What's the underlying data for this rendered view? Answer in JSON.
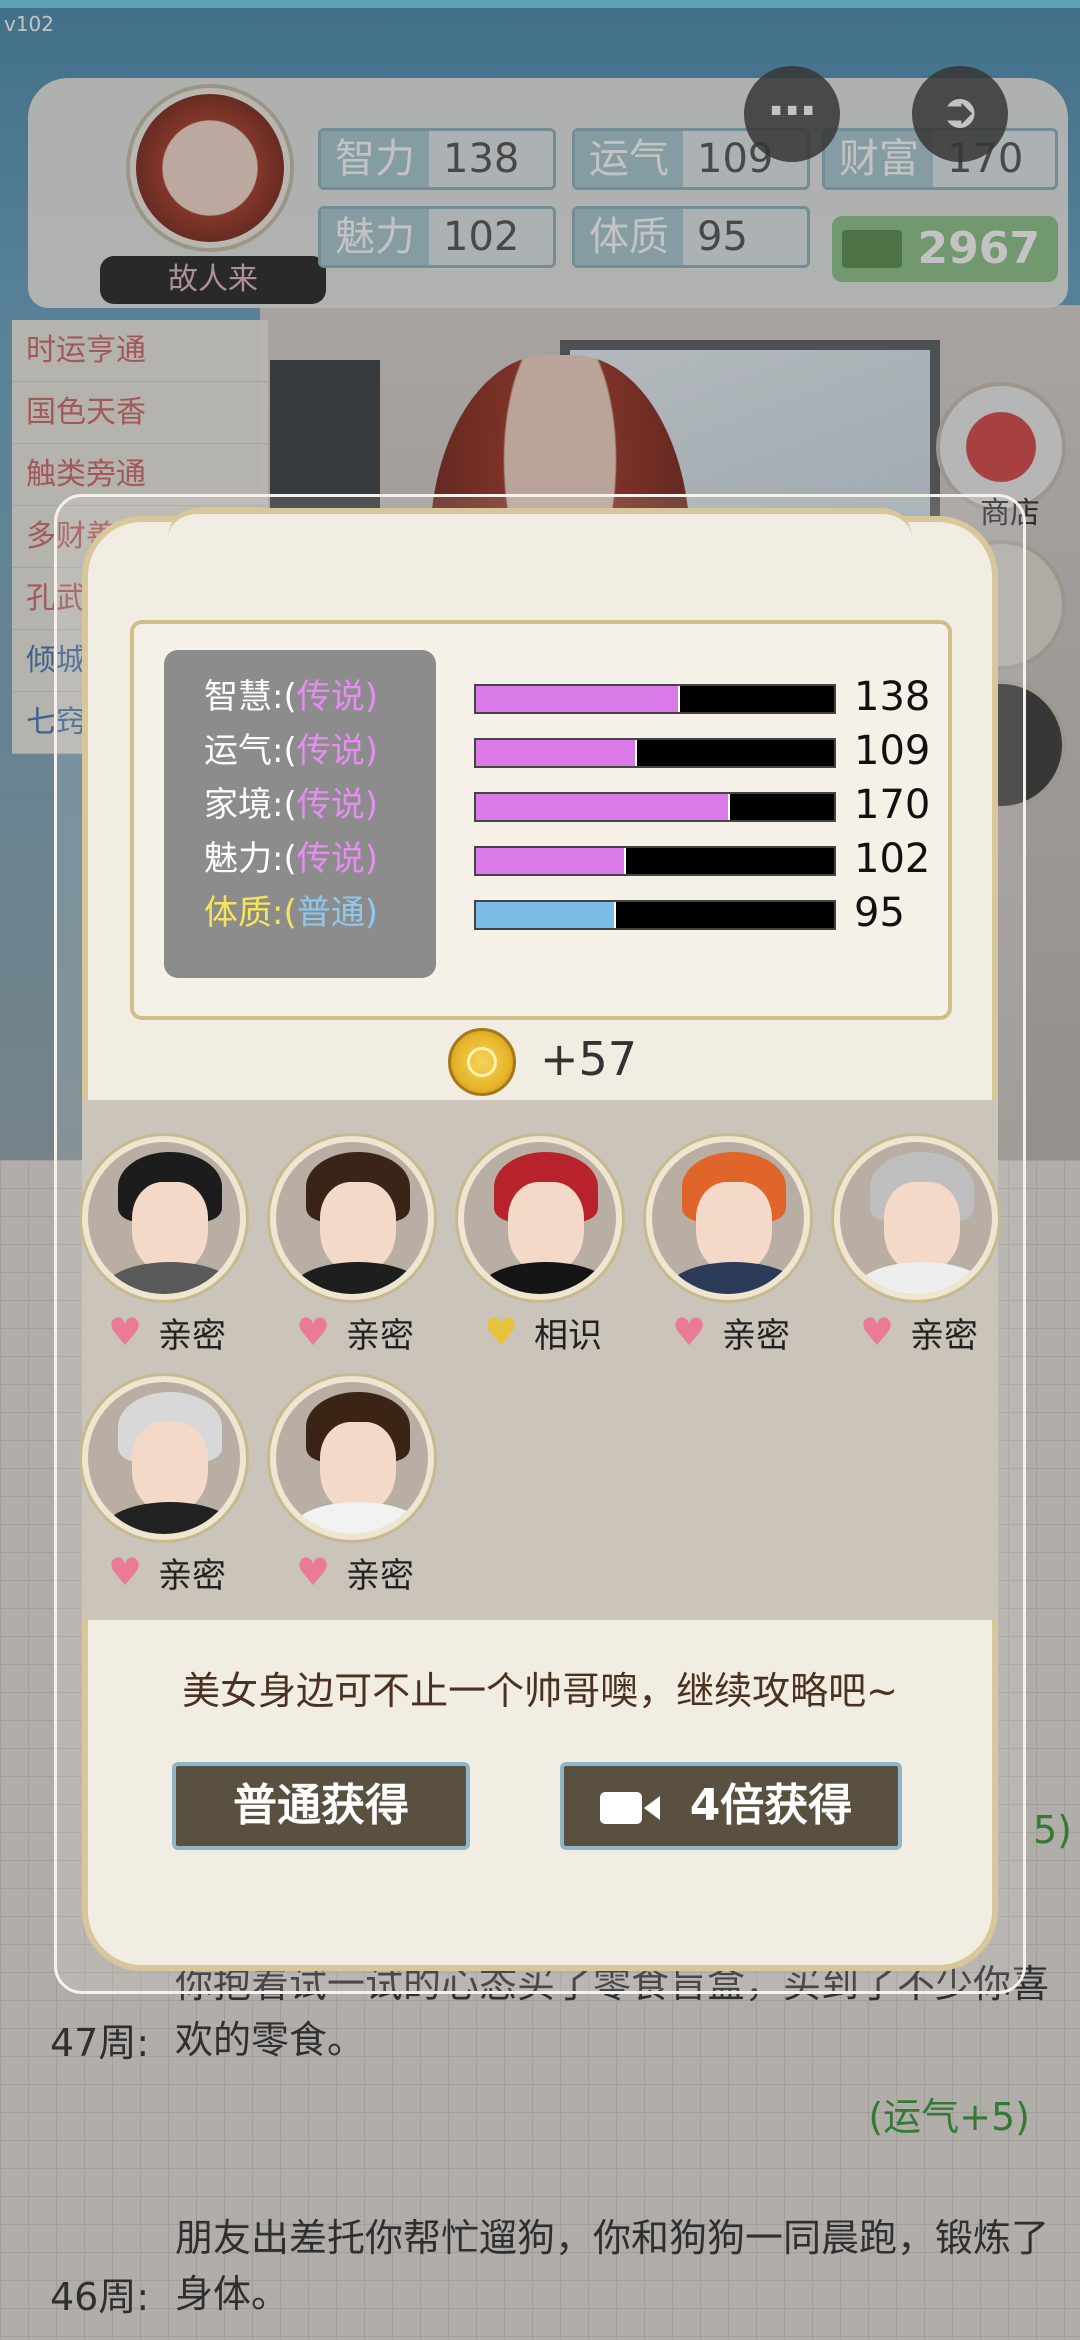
{
  "version": "v102",
  "header": {
    "player_name": "故人来",
    "stats": [
      {
        "label": "智力",
        "value": "138"
      },
      {
        "label": "运气",
        "value": "109"
      },
      {
        "label": "财富",
        "value": "170"
      },
      {
        "label": "魅力",
        "value": "102"
      },
      {
        "label": "体质",
        "value": "95"
      }
    ],
    "money": "2967",
    "more_icon": "more-dots-icon",
    "exit_icon": "exit-icon"
  },
  "talents": [
    "时运亨通",
    "国色天香",
    "触类旁通",
    "多财善贾",
    "孔武",
    "倾城",
    "七窍"
  ],
  "side": {
    "shop_label": "商店"
  },
  "modal": {
    "stats": [
      {
        "label": "智慧:(",
        "grade": "传说",
        "close": ")",
        "value": "138",
        "level": 0.57,
        "color": "#d97ae8"
      },
      {
        "label": "运气:(",
        "grade": "传说",
        "close": ")",
        "value": "109",
        "level": 0.45,
        "color": "#d97ae8"
      },
      {
        "label": "家境:(",
        "grade": "传说",
        "close": ")",
        "value": "170",
        "level": 0.71,
        "color": "#d97ae8"
      },
      {
        "label": "魅力:(",
        "grade": "传说",
        "close": ")",
        "value": "102",
        "level": 0.42,
        "color": "#d97ae8"
      },
      {
        "label": "体质:(",
        "grade": "普通",
        "close": ")",
        "value": "95",
        "level": 0.39,
        "color": "#7bbde6"
      }
    ],
    "reward": "+57",
    "friends": [
      {
        "status": "亲密",
        "heart": "pink"
      },
      {
        "status": "亲密",
        "heart": "pink"
      },
      {
        "status": "相识",
        "heart": "gold"
      },
      {
        "status": "亲密",
        "heart": "pink"
      },
      {
        "status": "亲密",
        "heart": "pink"
      },
      {
        "status": "亲密",
        "heart": "pink"
      },
      {
        "status": "亲密",
        "heart": "pink"
      }
    ],
    "hint": "美女身边可不止一个帅哥噢，继续攻略吧~",
    "btn_normal": "普通获得",
    "btn_4x": "4倍获得"
  },
  "log": [
    {
      "week": "47周:",
      "text": "你抱着试一试的心态买了零食盲盒，买到了不少你喜欢的零食。",
      "reward": "(运气+5)"
    },
    {
      "week": "46周:",
      "text": "朋友出差托你帮忙遛狗，你和狗狗一同晨跑，锻炼了身体。",
      "reward": ""
    }
  ],
  "log_edge": {
    "reward_top": "5)"
  }
}
